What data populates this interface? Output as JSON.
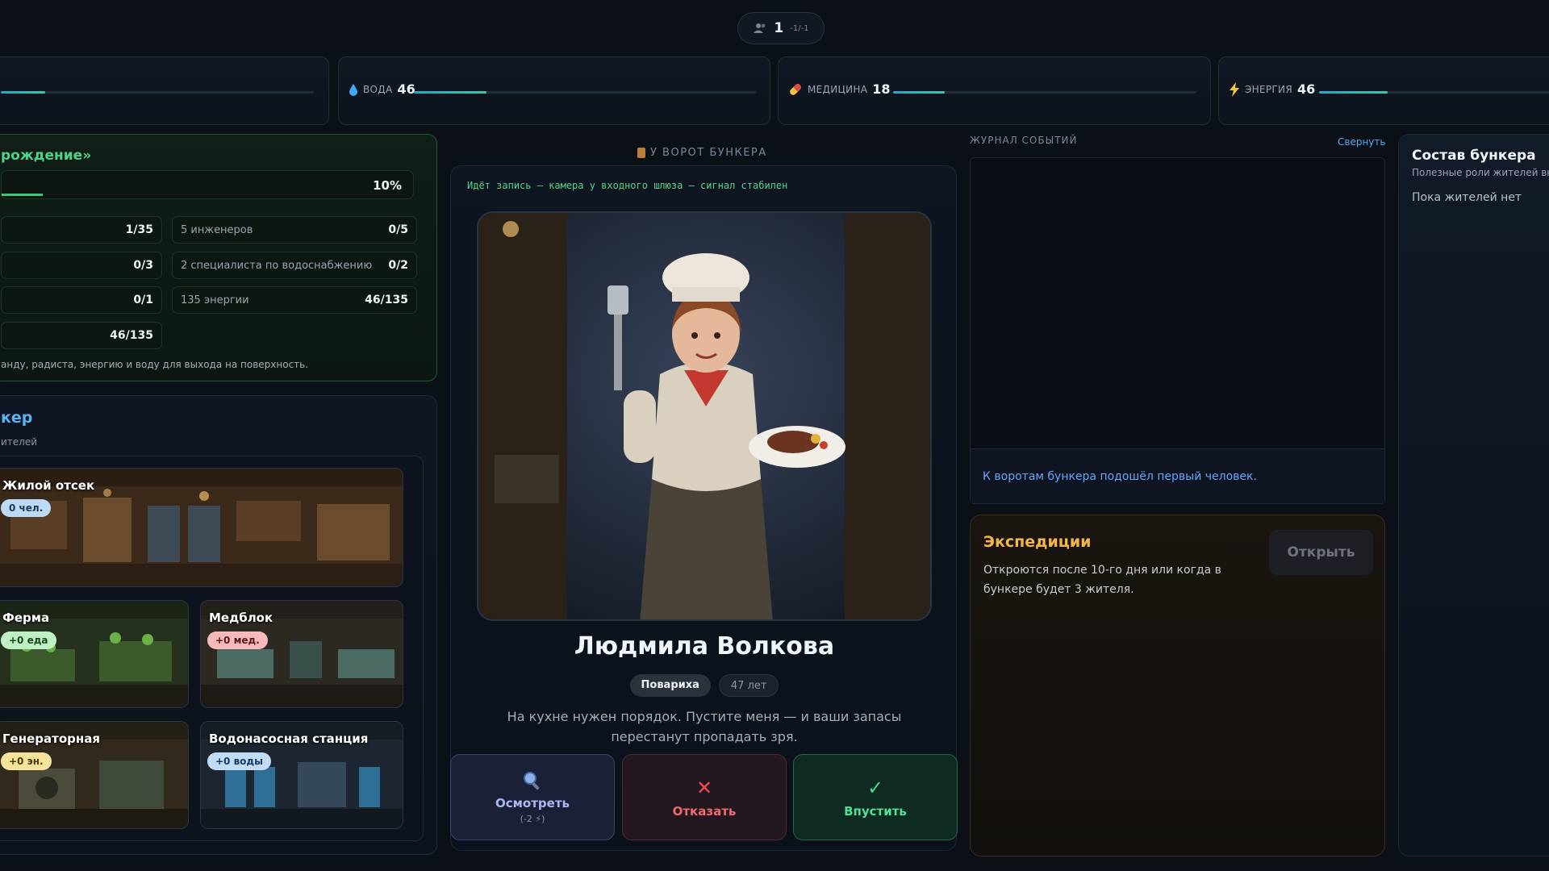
{
  "top": {
    "count": "1",
    "meta": "-1/-1"
  },
  "resources": [
    {
      "label": "",
      "value": "",
      "fill": 0.13,
      "icon": "food-icon"
    },
    {
      "label": "ВОДА",
      "value": "46",
      "fill": 0.34,
      "icon": "water-drop-icon",
      "color": "#3fa9f5"
    },
    {
      "label": "МЕДИЦИНА",
      "value": "18",
      "fill": 0.13,
      "icon": "pill-icon",
      "color": "#e04a4a"
    },
    {
      "label": "ЭНЕРГИЯ",
      "value": "46",
      "fill": 0.34,
      "icon": "lightning-icon",
      "color": "#f5c53f"
    }
  ],
  "goal": {
    "title": "рождение»",
    "progress_pct": "10%",
    "progress": 0.1,
    "reqs": [
      {
        "label": "",
        "value": "1/35"
      },
      {
        "label": "5 инженеров",
        "value": "0/5"
      },
      {
        "label": "",
        "value": "0/3"
      },
      {
        "label": "2 специалиста по водоснабжению",
        "value": "0/2"
      },
      {
        "label": "",
        "value": "0/1"
      },
      {
        "label": "135 энергии",
        "value": "46/135"
      },
      {
        "label": "",
        "value": "46/135"
      }
    ],
    "note": "анду, радиста, энергию и воду для выхода на поверхность."
  },
  "bunker": {
    "title": "кер",
    "subtitle": "ителей",
    "rooms": [
      {
        "name": "Жилой отсек",
        "badge": "0 чел."
      },
      {
        "name": "Ферма",
        "badge": "+0 еда"
      },
      {
        "name": "Медблок",
        "badge": "+0 мед."
      },
      {
        "name": "Генераторная",
        "badge": "+0 эн."
      },
      {
        "name": "Водонасосная станция",
        "badge": "+0 воды"
      }
    ]
  },
  "gate": {
    "header": "У ВОРОТ БУНКЕРА",
    "camera": "Идёт запись — камера у входного шлюза — сигнал стабилен",
    "name": "Людмила Волкова",
    "role": "Повариха",
    "age": "47 лет",
    "desc": "На кухне нужен порядок. Пустите меня — и ваши запасы перестанут пропадать зря.",
    "buttons": {
      "inspect": "Осмотреть",
      "inspect_cost": "(-2 ⚡)",
      "reject": "Отказать",
      "admit": "Впустить"
    }
  },
  "journal": {
    "title": "ЖУРНАЛ СОБЫТИЙ",
    "collapse": "Свернуть",
    "entries": [
      "К воротам бункера подошёл первый человек."
    ]
  },
  "expeditions": {
    "title": "Экспедиции",
    "desc": "Откроются после 10-го дня или когда в бункере будет 3 жителя.",
    "open": "Открыть"
  },
  "composition": {
    "title": "Состав бункера",
    "subtitle": "Полезные роли жителей вн",
    "empty": "Пока жителей нет"
  }
}
